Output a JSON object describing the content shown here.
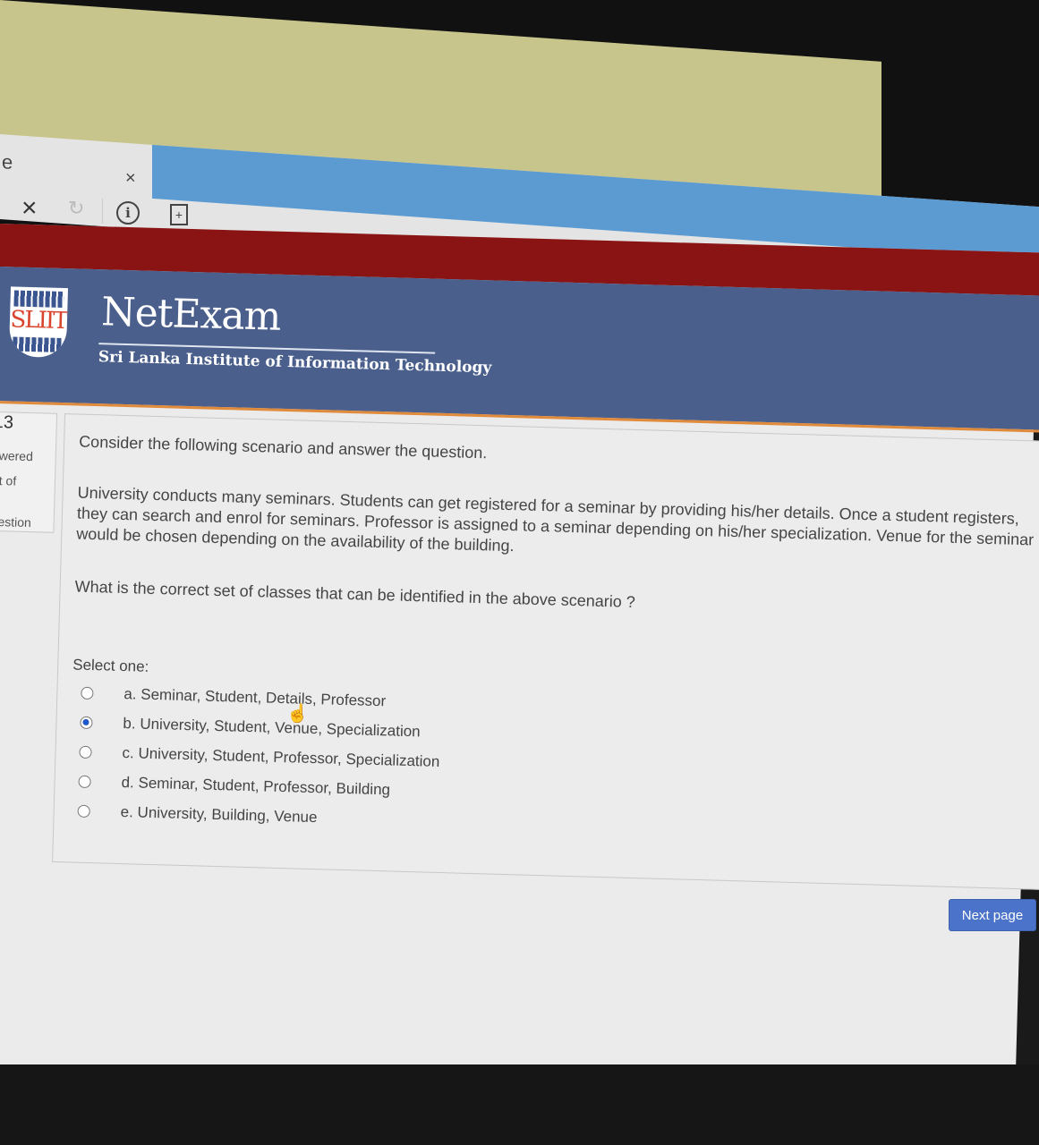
{
  "browser": {
    "tab_fragment": "e",
    "tab_close_icon": "×",
    "stop_icon": "×",
    "reload_icon": "↻",
    "info_icon": "i",
    "page_icon": "+"
  },
  "header": {
    "logo_text": "SLIIT",
    "app_name": "NetExam",
    "institution": "Sri Lanka Institute of Information Technology"
  },
  "question_nav": {
    "number": "13",
    "answered_fragment": "swered",
    "marks_fragment": "ut of",
    "flag_fragment": "uestion"
  },
  "question": {
    "intro": "Consider the following scenario and answer the question.",
    "scenario": "University conducts many seminars. Students can get registered for a seminar by providing his/her details. Once a student registers, they can search and enrol for seminars. Professor is assigned to a seminar depending on his/her specialization. Venue for the seminar would be chosen depending on the availability of the building.",
    "prompt": "What is the correct set of classes that can be identified in the above scenario ?",
    "select_label": "Select one:",
    "options": [
      {
        "label": "a. Seminar, Student, Details, Professor",
        "selected": false
      },
      {
        "label": "b. University, Student, Venue, Specialization",
        "selected": true
      },
      {
        "label": "c. University, Student, Professor, Specialization",
        "selected": false
      },
      {
        "label": "d. Seminar, Student, Professor, Building",
        "selected": false
      },
      {
        "label": "e. University, Building, Venue",
        "selected": false
      }
    ]
  },
  "footer": {
    "next_label": "Next page"
  },
  "colors": {
    "header_red": "#8a1414",
    "header_blue": "#4a5f8c",
    "accent_orange": "#e08a3c",
    "button_blue": "#4a73c9"
  }
}
